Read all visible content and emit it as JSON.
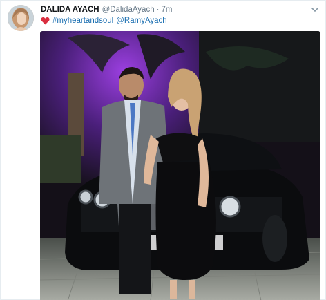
{
  "tweet": {
    "author_name": "DALIDA AYACH",
    "author_handle": "@DalidaAyach",
    "separator": "·",
    "time": "7m",
    "hashtag": "#myheartandsoul",
    "mention": "@RamyAyach"
  },
  "icons": {
    "avatar": "profile-avatar",
    "caret": "chevron-down-icon",
    "emoji": "red-heart-icon"
  },
  "colors": {
    "link": "#1b6fb1",
    "heart": "#d92e3f",
    "secondary_text": "#657786"
  }
}
